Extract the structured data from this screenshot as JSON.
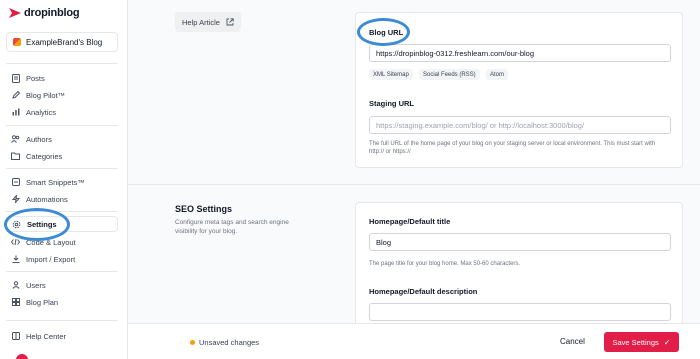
{
  "app": {
    "logo_text": "dropinblog",
    "brand_selector": "ExampleBrand's Blog"
  },
  "sidebar": {
    "items": [
      {
        "label": "Posts",
        "icon": "document-icon"
      },
      {
        "label": "Blog Pilot™",
        "icon": "pen-icon"
      },
      {
        "label": "Analytics",
        "icon": "chart-icon"
      },
      {
        "label": "Authors",
        "icon": "users-icon"
      },
      {
        "label": "Categories",
        "icon": "folder-icon"
      },
      {
        "label": "Smart Snippets™",
        "icon": "snippet-icon"
      },
      {
        "label": "Automations",
        "icon": "bolt-icon"
      },
      {
        "label": "Settings",
        "icon": "gear-icon",
        "active": true
      },
      {
        "label": "Code & Layout",
        "icon": "code-icon"
      },
      {
        "label": "Import / Export",
        "icon": "download-icon"
      },
      {
        "label": "Users",
        "icon": "user-icon"
      },
      {
        "label": "Blog Plan",
        "icon": "grid-icon"
      },
      {
        "label": "Help Center",
        "icon": "book-icon"
      }
    ]
  },
  "main": {
    "help_article": "Help Article",
    "blog_url": {
      "label": "Blog URL",
      "value": "https://dropinblog-0312.freshlearn.com/our-blog",
      "chips": [
        "XML Sitemap",
        "Social Feeds (RSS)",
        "Atom"
      ]
    },
    "staging_url": {
      "label": "Staging URL",
      "placeholder": "https://staging.example.com/blog/ or http://localhost:3000/blog/",
      "help": "The full URL of the home page of your blog on your staging server or local environment. This must start with http:// or https://"
    },
    "seo": {
      "title": "SEO Settings",
      "description": "Configure meta tags and search engine visibility for your blog.",
      "homepage_title_label": "Homepage/Default title",
      "homepage_title_value": "Blog",
      "homepage_title_help": "The page title for your blog home. Max 50-60 characters.",
      "homepage_desc_label": "Homepage/Default description"
    }
  },
  "footer": {
    "unsaved": "Unsaved changes",
    "cancel": "Cancel",
    "save": "Save Settings"
  },
  "colors": {
    "accent": "#e11d48",
    "annotation": "#3d8bd6",
    "unsaved_dot": "#f59e0b"
  }
}
